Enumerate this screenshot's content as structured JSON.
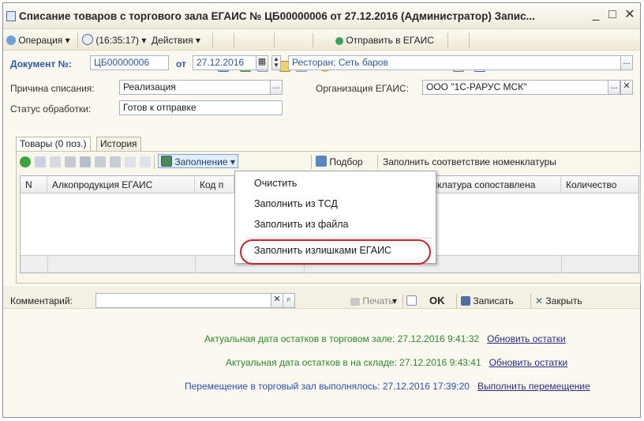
{
  "window": {
    "title": "Списание товаров с торгового зала ЕГАИС № ЦБ00000006 от 27.12.2016 (Администратор) Запис...",
    "minimize": "_",
    "maximize": "□",
    "close": "✕"
  },
  "toolbar": {
    "operation": "Операция ▾",
    "time": "(16:35:17) ▾",
    "actions": "Действия ▾",
    "send": "Отправить в ЕГАИС"
  },
  "header": {
    "doc_label": "Документ №:",
    "doc_number": "ЦБ00000006",
    "from_label": "от",
    "date": "27.12.2016",
    "store": "Ресторан; Сеть баров",
    "reason_label": "Причина списания:",
    "reason": "Реализация",
    "org_label": "Организация ЕГАИС:",
    "org": "ООО \"1С-РАРУС МСК\"",
    "status_label": "Статус обработки:",
    "status": "Готов к отправке"
  },
  "tabs": [
    {
      "label": "Товары (0 поз.)"
    },
    {
      "label": "История"
    }
  ],
  "table_toolbar": {
    "fill": "Заполнение ▾",
    "pick": "Подбор",
    "fill_match": "Заполнить соответствие номенклатуры"
  },
  "grid": {
    "columns": [
      "N",
      "Алкопродукция ЕГАИС",
      "Код п",
      "",
      "енклатура сопоставлена",
      "Количество"
    ]
  },
  "dropdown": {
    "items": [
      {
        "label": "Очистить"
      },
      {
        "label": "Заполнить из ТСД"
      },
      {
        "label": "Заполнить из файла"
      },
      {
        "label": "Заполнить излишками ЕГАИС"
      }
    ]
  },
  "bottom": {
    "comment_label": "Комментарий:",
    "comment_value": "",
    "print": "Печать",
    "ok": "OK",
    "save": "Записать",
    "close": "Закрыть"
  },
  "info": {
    "line1_text": "Актуальная дата остатков в торговом зале: 27.12.2016 9:41:32",
    "line1_link": "Обновить остатки",
    "line2_text": "Актуальная дата остатков в на складе: 27.12.2016 9:43:41",
    "line2_link": "Обновить остатки",
    "line3_text": "Перемещение в торговый зал выполнялось: 27.12.2016 17:39:20",
    "line3_link": "Выполнить перемещение"
  },
  "colors": {
    "accent_blue": "#2a57a8",
    "info_green": "#2a8a2a",
    "highlight_red": "#c7232b"
  }
}
